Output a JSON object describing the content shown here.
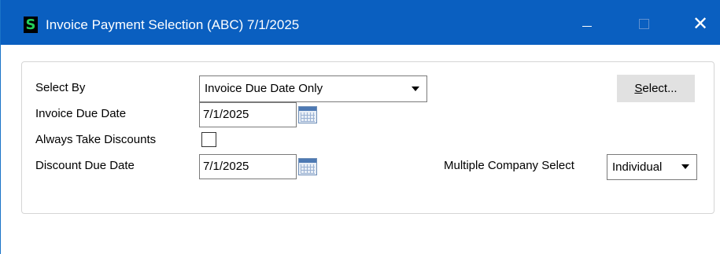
{
  "window": {
    "title": "Invoice Payment Selection (ABC) 7/1/2025",
    "app_icon_glyph": "S",
    "minimize_glyph": "",
    "maximize_glyph": "",
    "close_glyph": "✕"
  },
  "form": {
    "select_by": {
      "label": "Select By",
      "value": "Invoice Due Date Only"
    },
    "invoice_due_date": {
      "label": "Invoice Due Date",
      "value": "7/1/2025"
    },
    "always_take_discounts": {
      "label": "Always Take Discounts",
      "checked": false
    },
    "discount_due_date": {
      "label": "Discount Due Date",
      "value": "7/1/2025"
    },
    "multiple_company_select": {
      "label": "Multiple Company Select",
      "value": "Individual"
    },
    "select_button": {
      "mnemonic": "S",
      "rest": "elect..."
    }
  },
  "icons": {
    "app": "sage-s-icon",
    "calendar": "calendar-icon",
    "dropdown": "chevron-down-icon"
  },
  "colors": {
    "titlebar": "#0a5fc0",
    "app_icon_glyph": "#23d05a",
    "button_face": "#e1e1e1"
  }
}
